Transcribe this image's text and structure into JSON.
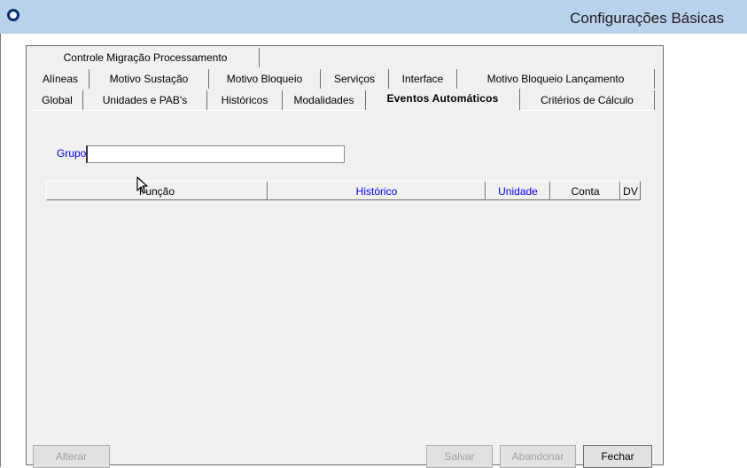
{
  "window": {
    "title": "Configurações Básicas",
    "icon": "app-ring-icon"
  },
  "tabs": {
    "row1": [
      {
        "label": "Controle Migração Processamento"
      }
    ],
    "row2": [
      {
        "label": "Alíneas"
      },
      {
        "label": "Motivo Sustação"
      },
      {
        "label": "Motivo Bloqueio"
      },
      {
        "label": "Serviços"
      },
      {
        "label": "Interface"
      },
      {
        "label": "Motivo Bloqueio Lançamento"
      }
    ],
    "row3": [
      {
        "label": "Global"
      },
      {
        "label": "Unidades e PAB's"
      },
      {
        "label": "Históricos"
      },
      {
        "label": "Modalidades"
      },
      {
        "label": "Eventos Automáticos",
        "selected": true
      },
      {
        "label": "Critérios de Cálculo"
      }
    ]
  },
  "form": {
    "grupo_label": "Grupo",
    "grupo_value": ""
  },
  "grid": {
    "columns": [
      "Função",
      "Histórico",
      "Unidade",
      "Conta",
      "DV"
    ],
    "rows": []
  },
  "buttons": {
    "alterar": "Alterar",
    "salvar": "Salvar",
    "abandonar": "Abandonar",
    "fechar": "Fechar"
  },
  "colors": {
    "titlebar": "#b9d1ea",
    "label_blue": "#0000ff",
    "panel": "#f0f0f0"
  }
}
